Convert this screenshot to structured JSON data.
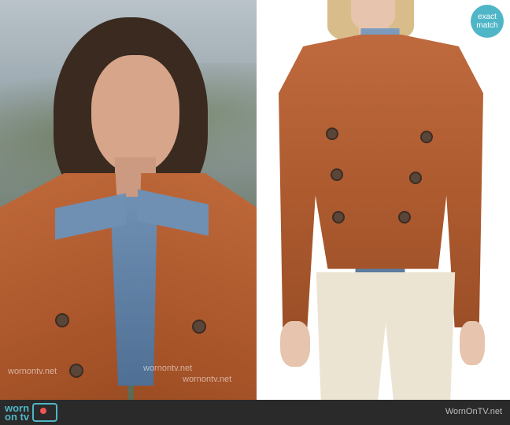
{
  "badge": {
    "line1": "exact",
    "line2": "match",
    "color": "#4fb6c7"
  },
  "watermark": "wornontv.net",
  "footer": {
    "logo_line1": "worn",
    "logo_line2": "on tv",
    "site_name": "WornOnTV.net",
    "accent_color": "#4fb6c7"
  },
  "left_panel": {
    "description_icon": "person-photo-icon"
  },
  "right_panel": {
    "description_icon": "product-photo-icon"
  }
}
